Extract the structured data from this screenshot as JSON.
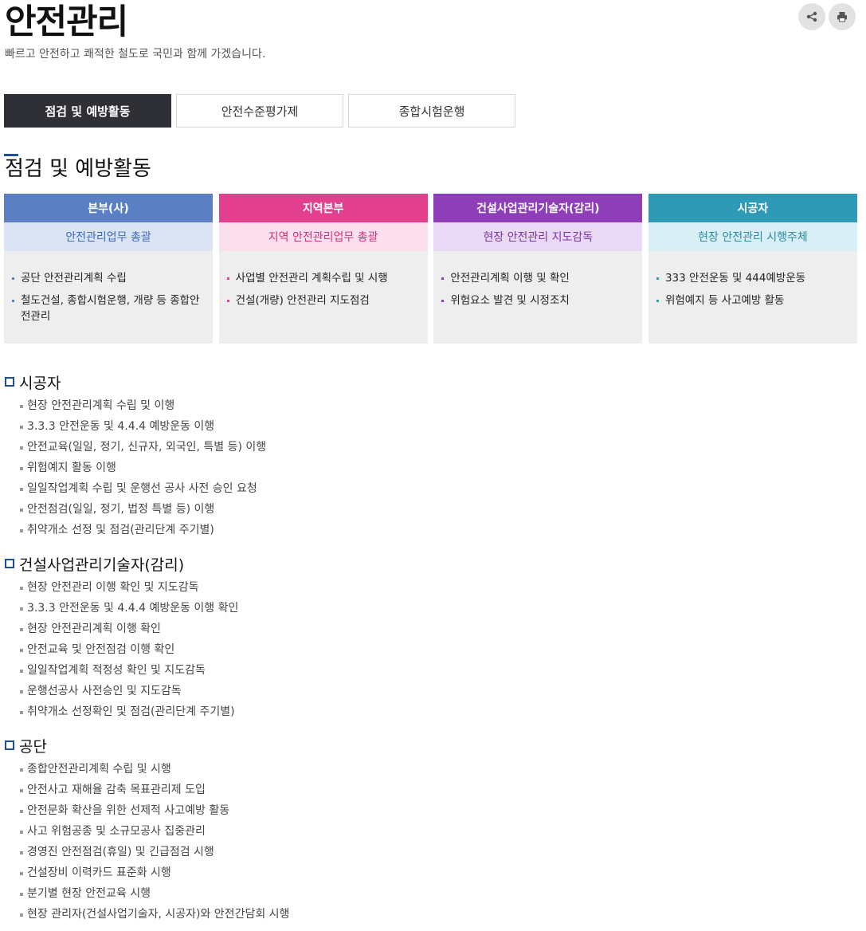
{
  "page": {
    "title": "안전관리",
    "description": "빠르고 안전하고 쾌적한 철도로 국민과 함께 가겠습니다."
  },
  "header_icons": [
    {
      "icon": "share-icon"
    },
    {
      "icon": "print-icon"
    }
  ],
  "tabs": [
    {
      "label": "점검 및 예방활동",
      "active": true
    },
    {
      "label": "안전수준평가제",
      "active": false
    },
    {
      "label": "종합시험운행",
      "active": false
    }
  ],
  "section": {
    "title": "점검 및 예방활동"
  },
  "org_columns": [
    {
      "title": "본부(사)",
      "subtitle": "안전관리업무 총괄",
      "color": "#5a7fc2",
      "sub_bg": "#dbe4f4",
      "sub_color": "#3b6bc0",
      "items": [
        "공단 안전관리계획 수립",
        "철도건설, 종합시험운행, 개량 등 종합안전관리"
      ]
    },
    {
      "title": "지역본부",
      "subtitle": "지역 안전관리업무 총괄",
      "color": "#e2408e",
      "sub_bg": "#fbdfec",
      "sub_color": "#d0327c",
      "items": [
        "사업별 안전관리 계획수립 및 시행",
        "건설(개량) 안전관리 지도점검"
      ]
    },
    {
      "title": "건설사업관리기술자(감리)",
      "subtitle": "현장 안전관리 지도감독",
      "color": "#8e3fb8",
      "sub_bg": "#ead9f4",
      "sub_color": "#7a34a3",
      "items": [
        "안전관리계획 이행 및 확인",
        "위험요소 발견 및 시정조치"
      ]
    },
    {
      "title": "시공자",
      "subtitle": "현장 안전관리 시행주체",
      "color": "#2f9ab6",
      "sub_bg": "#d8eff5",
      "sub_color": "#2a8aa5",
      "items": [
        "333 안전운동 및 444예방운동",
        "위험예지 등 사고예방 활동"
      ]
    }
  ],
  "blocks": [
    {
      "title": "시공자",
      "items": [
        "현장 안전관리계획 수립 및 이행",
        "3.3.3 안전운동 및 4.4.4 예방운동 이행",
        "안전교육(일일, 정기, 신규자, 외국인, 특별 등) 이행",
        "위험예지 활동 이행",
        "일일작업계획 수립 및 운행선 공사 사전 승인 요청",
        "안전점검(일일, 정기, 법정 특별 등) 이행",
        "취약개소 선정 및 점검(관리단계 주기별)"
      ]
    },
    {
      "title": "건설사업관리기술자(감리)",
      "items": [
        "현장 안전관리 이행 확인 및 지도감독",
        "3.3.3 안전운동 및 4.4.4 예방운동 이행 확인",
        "현장 안전관리계획 이행 확인",
        "안전교육 및 안전점검 이행 확인",
        "일일작업계획 적정성 확인 및 지도감독",
        "운행선공사 사전승인 및 지도감독",
        "취약개소 선정확인 및 점검(관리단계 주기별)"
      ]
    },
    {
      "title": "공단",
      "items": [
        "종합안전관리계획 수립 및 시행",
        "안전사고 재해율 감축 목표관리제 도입",
        "안전문화 확산을 위한 선제적 사고예방 활동",
        "사고 위험공종 및 소규모공사 집중관리",
        "경영진 안전점검(휴일) 및 긴급점검 시행",
        "건설장비 이력카드 표준화 시행",
        "분기별 현장 안전교육 시행",
        "현장 관리자(건설사업기술자, 시공자)와 안전간담회 시행"
      ]
    }
  ]
}
